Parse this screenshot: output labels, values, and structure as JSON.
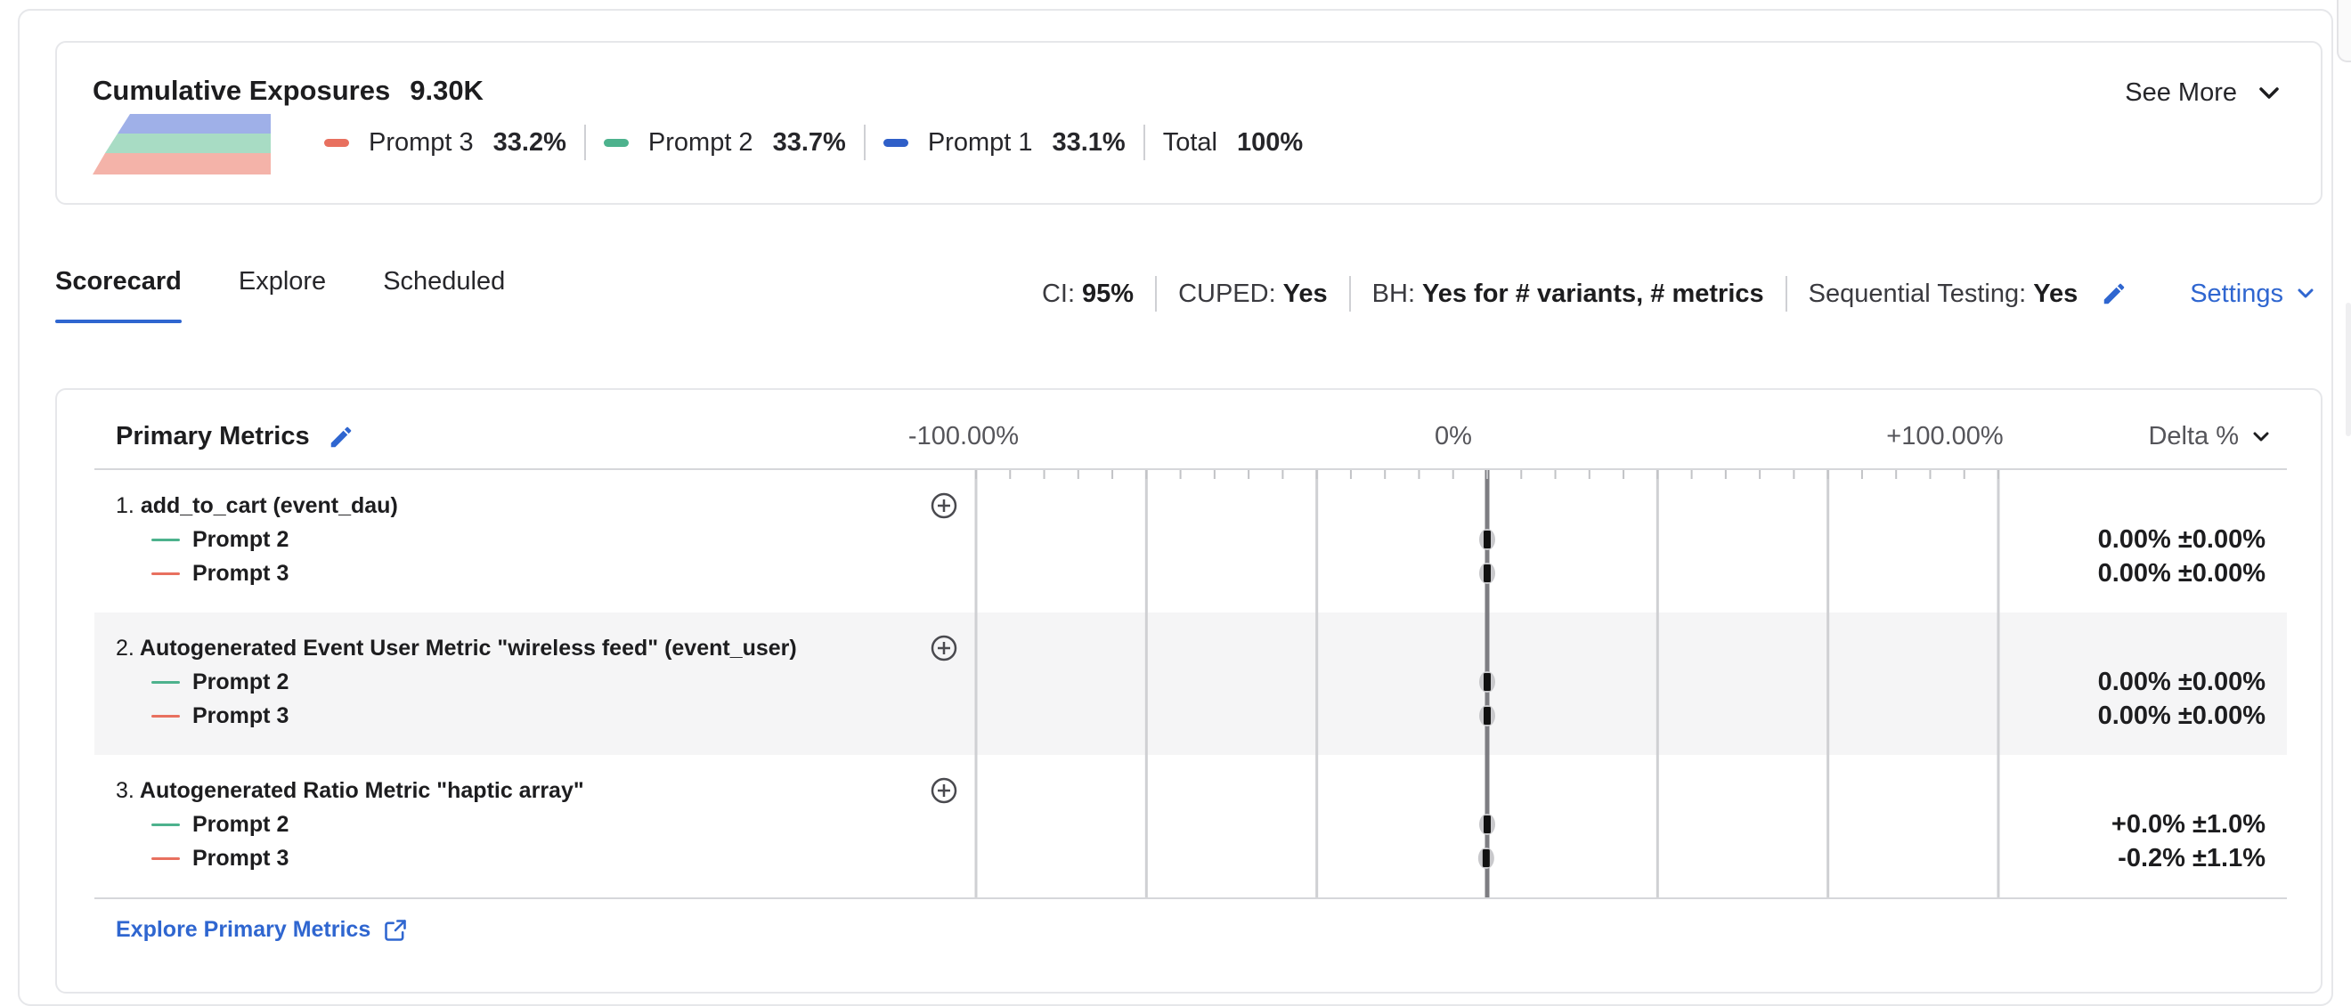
{
  "exposures": {
    "title": "Cumulative Exposures",
    "total": "9.30K",
    "legend": [
      {
        "label": "Prompt 3",
        "value": "33.2%",
        "color": "#e8705f"
      },
      {
        "label": "Prompt 2",
        "value": "33.7%",
        "color": "#4db28d"
      },
      {
        "label": "Prompt 1",
        "value": "33.1%",
        "color": "#2f5fc8"
      },
      {
        "label": "Total",
        "value": "100%"
      }
    ],
    "see_more": "See More",
    "chart_colors": {
      "prompt1": "#9fb0e8",
      "prompt2": "#a8dcc4",
      "prompt3": "#f4b3a9"
    }
  },
  "tabs": [
    {
      "label": "Scorecard",
      "active": true
    },
    {
      "label": "Explore",
      "active": false
    },
    {
      "label": "Scheduled",
      "active": false
    }
  ],
  "settings": {
    "ci_label": "CI:",
    "ci_value": "95%",
    "cuped_label": "CUPED:",
    "cuped_value": "Yes",
    "bh_label": "BH:",
    "bh_value": "Yes for # variants, # metrics",
    "seq_label": "Sequential Testing:",
    "seq_value": "Yes",
    "settings_link": "Settings"
  },
  "metrics": {
    "title": "Primary Metrics",
    "axis": {
      "min_label": "-100.00%",
      "zero_label": "0%",
      "max_label": "+100.00%"
    },
    "delta_header": "Delta %",
    "rows": [
      {
        "num": "1.",
        "name": "add_to_cart (event_dau)",
        "variants": [
          {
            "label": "Prompt 2",
            "color": "#4db28d",
            "delta": "0.00% ±0.00%",
            "value": 0.0
          },
          {
            "label": "Prompt 3",
            "color": "#e8705f",
            "delta": "0.00% ±0.00%",
            "value": 0.0
          }
        ]
      },
      {
        "num": "2.",
        "name": "Autogenerated Event User Metric \"wireless feed\" (event_user)",
        "variants": [
          {
            "label": "Prompt 2",
            "color": "#4db28d",
            "delta": "0.00% ±0.00%",
            "value": 0.0
          },
          {
            "label": "Prompt 3",
            "color": "#e8705f",
            "delta": "0.00% ±0.00%",
            "value": 0.0
          }
        ]
      },
      {
        "num": "3.",
        "name": "Autogenerated Ratio Metric \"haptic array\"",
        "variants": [
          {
            "label": "Prompt 2",
            "color": "#4db28d",
            "delta": "+0.0% ±1.0%",
            "value": 0.0
          },
          {
            "label": "Prompt 3",
            "color": "#e8705f",
            "delta": "-0.2% ±1.1%",
            "value": -0.2
          }
        ]
      }
    ],
    "explore_link": "Explore Primary Metrics"
  }
}
